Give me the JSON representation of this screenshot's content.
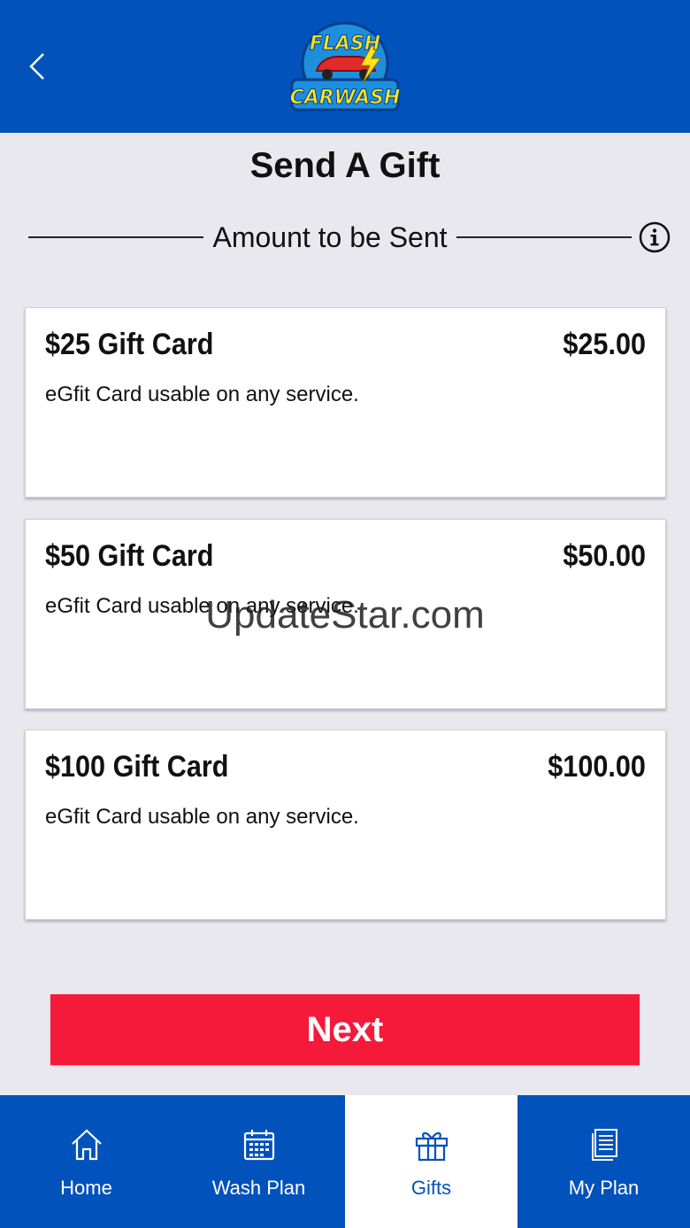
{
  "header": {
    "logo_line1": "FLASH",
    "logo_line2": "CARWASH"
  },
  "page": {
    "title": "Send A Gift",
    "section_label": "Amount to be Sent"
  },
  "cards": [
    {
      "name": "$25 Gift Card",
      "price": "$25.00",
      "description": "eGfit Card usable on any service."
    },
    {
      "name": "$50 Gift Card",
      "price": "$50.00",
      "description": "eGfit Card usable on any service."
    },
    {
      "name": "$100 Gift Card",
      "price": "$100.00",
      "description": "eGfit Card usable on any service."
    }
  ],
  "watermark": "UpdateStar.com",
  "next_label": "Next",
  "nav": {
    "items": [
      {
        "label": "Home",
        "icon": "home-icon"
      },
      {
        "label": "Wash Plan",
        "icon": "calendar-icon"
      },
      {
        "label": "Gifts",
        "icon": "gift-icon"
      },
      {
        "label": "My Plan",
        "icon": "document-icon"
      }
    ],
    "active_index": 2
  },
  "colors": {
    "brand_blue": "#0252bc",
    "accent_red": "#f51a3a",
    "background": "#e9e8ef"
  }
}
